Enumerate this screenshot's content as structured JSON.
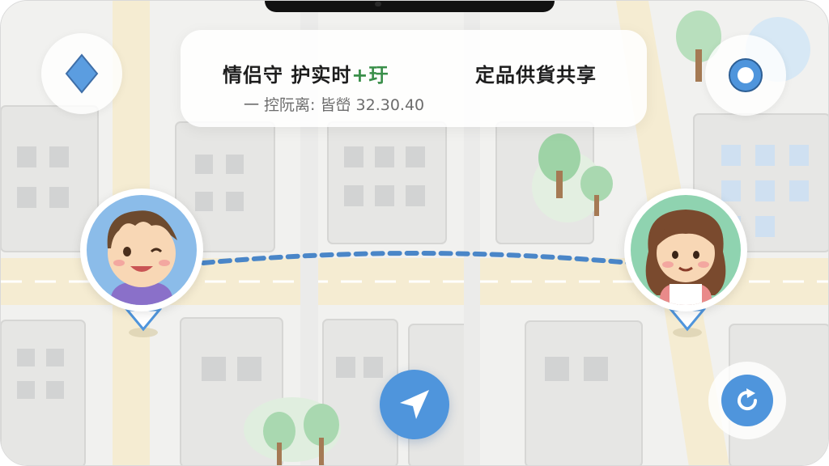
{
  "header": {
    "title_left": "情侣守 护实时",
    "title_left_accent": "+玗",
    "title_right": "定品供貨共享",
    "subtitle": "一 控阮离: 皆嵤 32.30.40"
  },
  "icons": {
    "left_button": "diamond-icon",
    "right_button": "location-target-icon",
    "nav_button": "navigation-arrow-icon",
    "refresh_button": "refresh-icon",
    "avatar_left": "boy-avatar",
    "avatar_right": "girl-avatar"
  },
  "colors": {
    "accent_blue": "#4f95dc",
    "route_line": "#4a86c8",
    "accent_green": "#3a8f4a",
    "road_yellow": "#f6e9c2"
  }
}
